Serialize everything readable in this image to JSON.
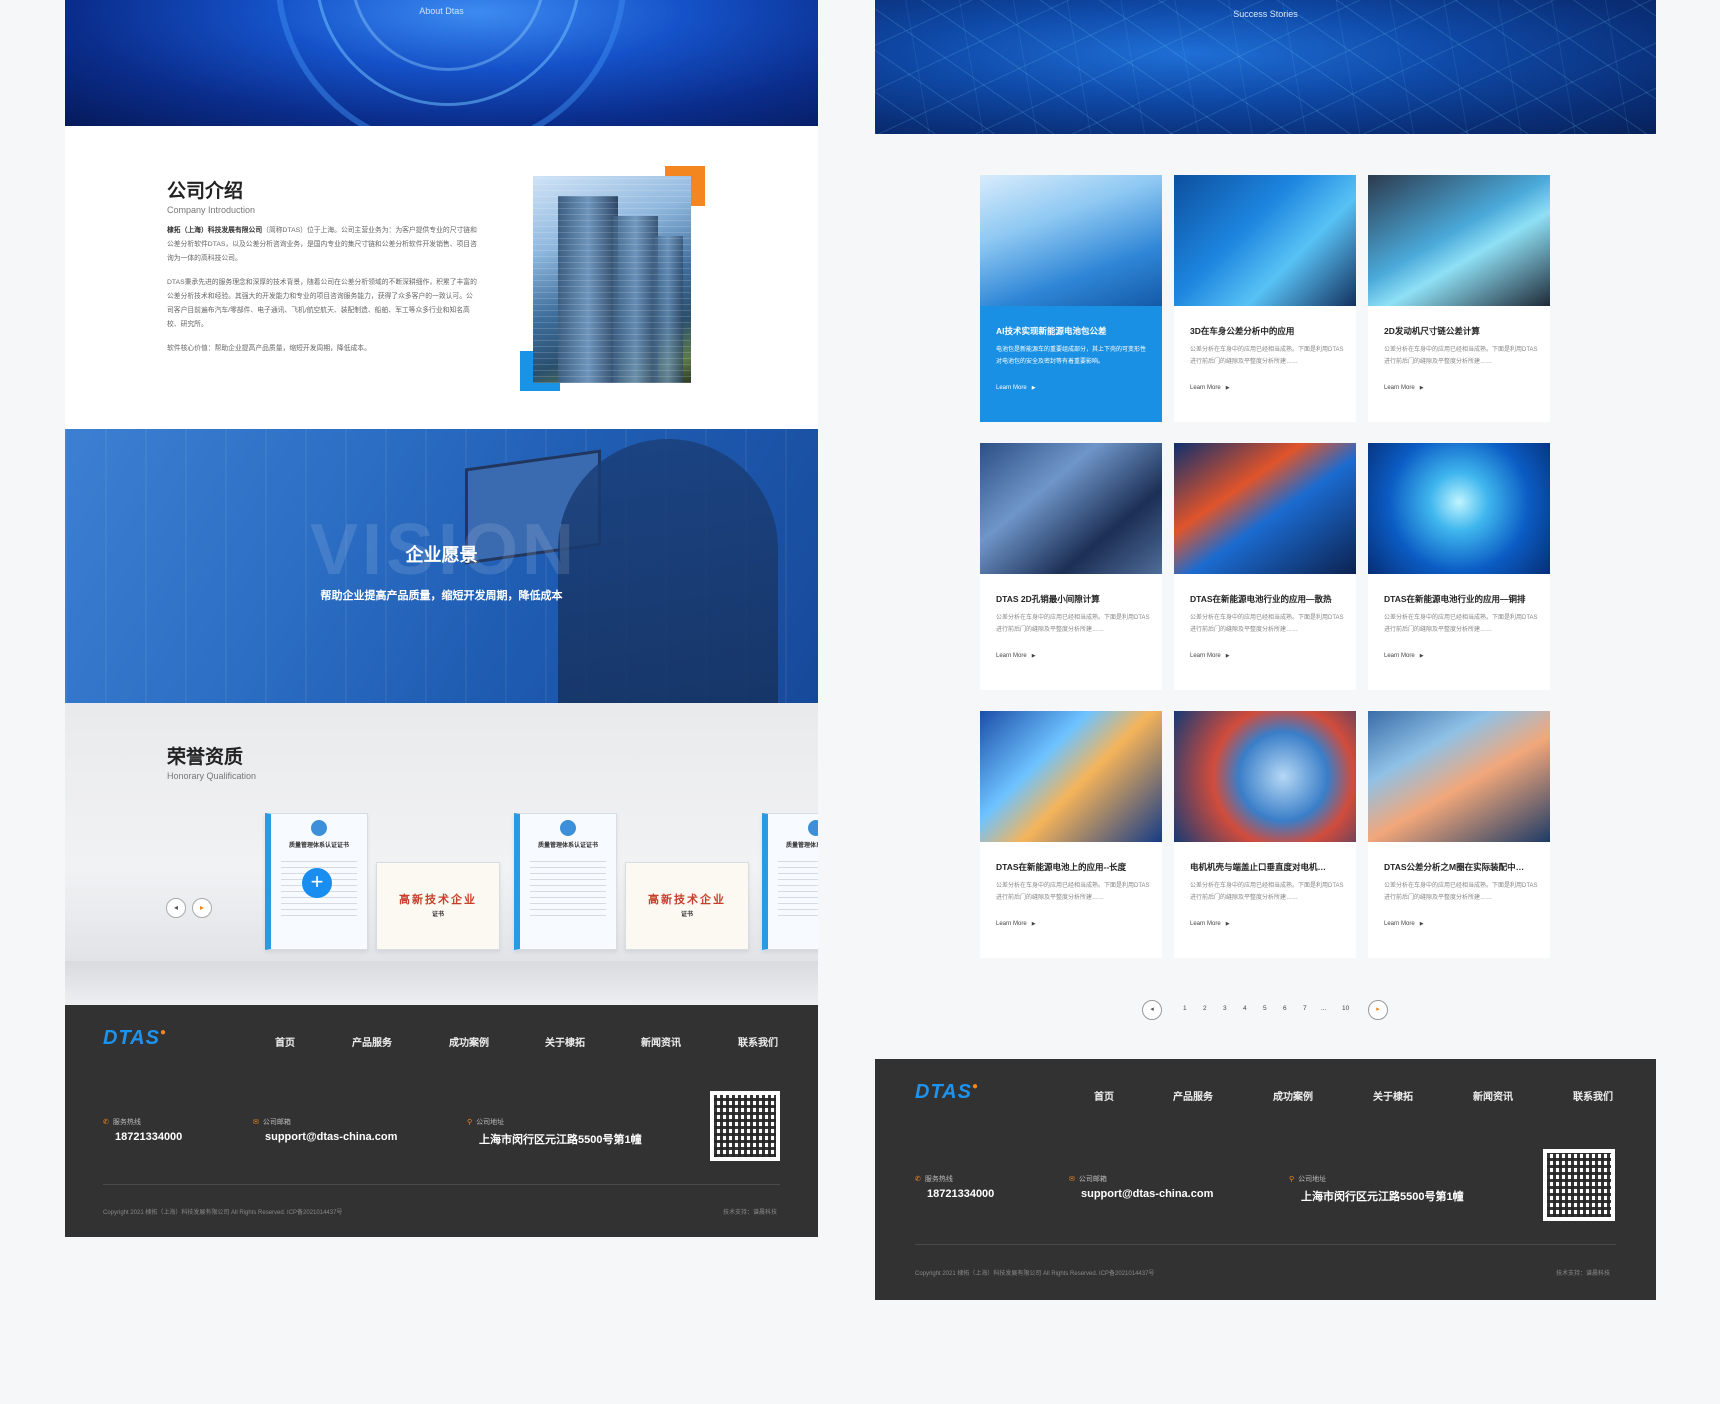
{
  "left": {
    "banner_subtitle": "About Dtas",
    "intro": {
      "title": "公司介绍",
      "subtitle": "Company Introduction",
      "p1_bold": "棣拓（上海）科技发展有限公司",
      "p1": "（简称DTAS）位于上海。公司主营业务为：为客户提供专业的尺寸链和公差分析软件DTAS，以及公差分析咨询业务，是国内专业的集尺寸链和公差分析软件开发销售、项目咨询为一体的高科技公司。",
      "p2": "DTAS秉承先进的服务理念和深厚的技术背景，随着公司在公差分析领域的不断深耕细作，积累了丰富的公差分析技术和经验。其强大的开发能力和专业的项目咨询服务能力，获得了众多客户的一致认可。公司客户目前遍布汽车/零部件、电子通讯、飞机/航空航天、装配制造、船舶、军工等众多行业和知名高校、研究所。",
      "p3": "软件核心价值：帮助企业提高产品质量，缩短开发周期，降低成本。"
    },
    "vision": {
      "bigword": "VISION",
      "title": "企业愿景",
      "slogan": "帮助企业提高产品质量，缩短开发周期，降低成本"
    },
    "honor": {
      "title": "荣誉资质",
      "subtitle": "Honorary Qualification",
      "cert_blue_title": "质量管理体系认证证书",
      "cert_gold_title": "高新技术企业",
      "cert_gold_sub": "证书",
      "plus": "+",
      "prev": "◂",
      "next": "▸"
    }
  },
  "footer": {
    "logo": "DTAS",
    "logo_mark": "●",
    "nav": [
      "首页",
      "产品服务",
      "成功案例",
      "关于棣拓",
      "新闻资讯",
      "联系我们"
    ],
    "hotline_label": "服务热线",
    "hotline": "18721334000",
    "email_label": "公司邮箱",
    "email": "support@dtas-china.com",
    "address_label": "公司地址",
    "address": "上海市闵行区元江路5500号第1幢",
    "copyright": "Copyright 2021 棣拓（上海）科技发展有限公司   All Rights Reserved.  ICP备2021014437号",
    "tech_support": "技术支持：谱晨科技",
    "icon_phone": "✆",
    "icon_mail": "✉",
    "icon_pin": "⚲"
  },
  "right": {
    "banner_subtitle": "Success Stories",
    "cards": [
      {
        "title": "AI技术实现新能源电池包公差",
        "desc": "电池包是新能源车的重要组成部分，其上下壳的可变形性对电池包的安全及密封等有着重要影响。",
        "more": "Learn More",
        "active": true
      },
      {
        "title": "3D在车身公差分析中的应用",
        "desc": "公差分析在车身中的应用已经相当成熟。下面是利用DTAS进行前后门的缝隙及平整度分析所建……",
        "more": "Learn More",
        "active": false
      },
      {
        "title": "2D发动机尺寸链公差计算",
        "desc": "公差分析在车身中的应用已经相当成熟。下面是利用DTAS进行前后门的缝隙及平整度分析所建……",
        "more": "Learn More",
        "active": false
      },
      {
        "title": "DTAS 2D孔销最小间隙计算",
        "desc": "公差分析在车身中的应用已经相当成熟。下面是利用DTAS进行前后门的缝隙及平整度分析所建……",
        "more": "Learn More",
        "active": false
      },
      {
        "title": "DTAS在新能源电池行业的应用—散热",
        "desc": "公差分析在车身中的应用已经相当成熟。下面是利用DTAS进行前后门的缝隙及平整度分析所建……",
        "more": "Learn More",
        "active": false
      },
      {
        "title": "DTAS在新能源电池行业的应用—铜排",
        "desc": "公差分析在车身中的应用已经相当成熟。下面是利用DTAS进行前后门的缝隙及平整度分析所建……",
        "more": "Learn More",
        "active": false
      },
      {
        "title": "DTAS在新能源电池上的应用--长度",
        "desc": "公差分析在车身中的应用已经相当成熟。下面是利用DTAS进行前后门的缝隙及平整度分析所建……",
        "more": "Learn More",
        "active": false
      },
      {
        "title": "电机机壳与端盖止口垂直度对电机…",
        "desc": "公差分析在车身中的应用已经相当成熟。下面是利用DTAS进行前后门的缝隙及平整度分析所建……",
        "more": "Learn More",
        "active": false
      },
      {
        "title": "DTAS公差分析之M圈在实际装配中…",
        "desc": "公差分析在车身中的应用已经相当成熟。下面是利用DTAS进行前后门的缝隙及平整度分析所建……",
        "more": "Learn More",
        "active": false
      }
    ],
    "more_arrow": "▶",
    "pagination": {
      "prev": "◂",
      "next": "▸",
      "pages": [
        "1",
        "2",
        "3",
        "4",
        "5",
        "6",
        "7",
        "...",
        "10"
      ]
    }
  }
}
